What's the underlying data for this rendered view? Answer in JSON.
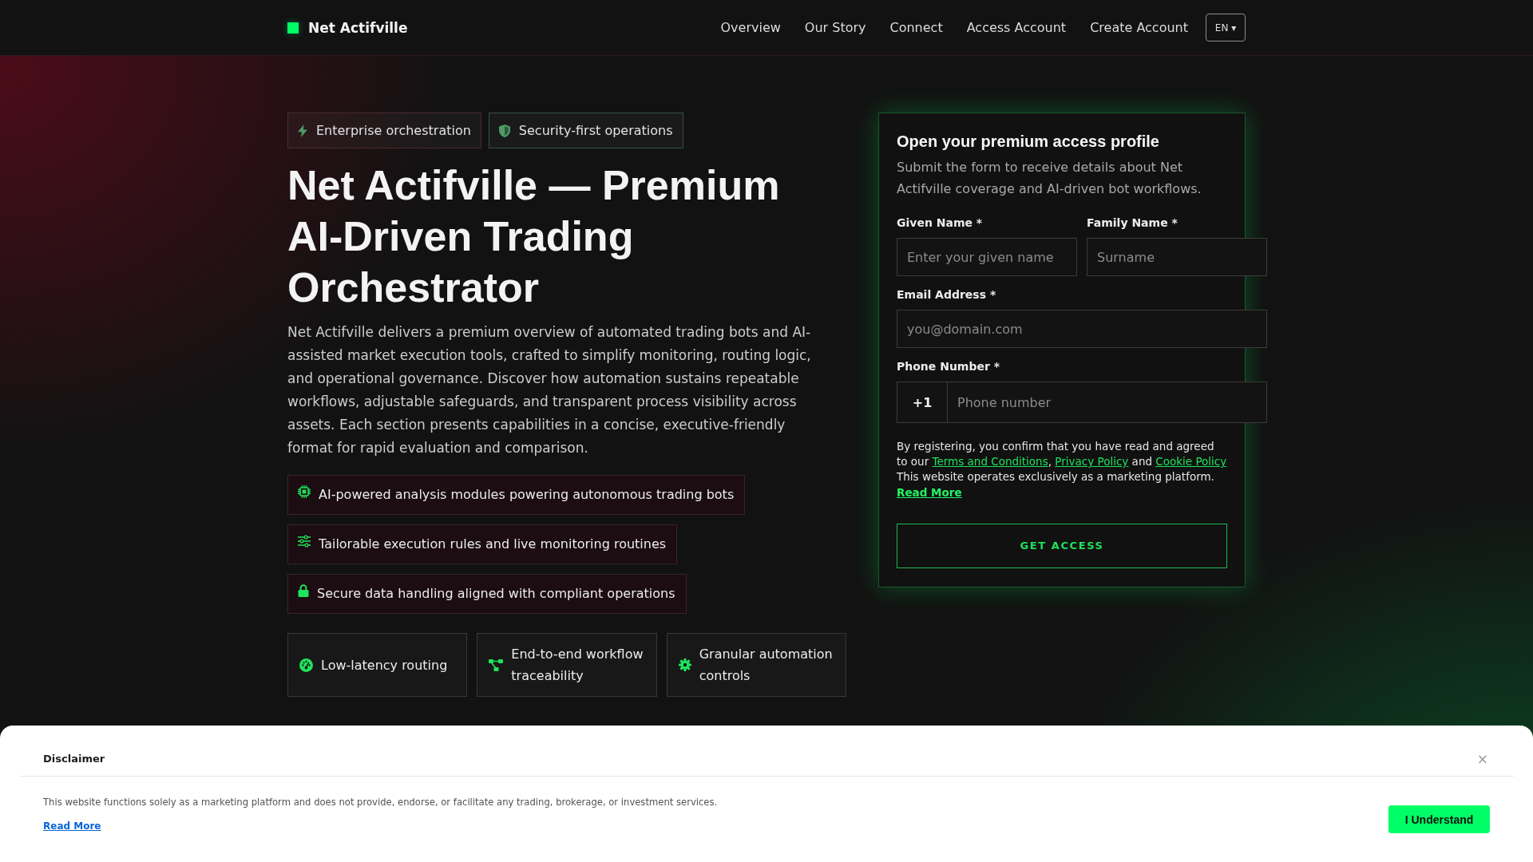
{
  "header": {
    "brand": "Net Actifville",
    "nav": [
      {
        "label": "Overview"
      },
      {
        "label": "Our Story"
      },
      {
        "label": "Connect"
      },
      {
        "label": "Access Account"
      },
      {
        "label": "Create Account"
      }
    ],
    "language": {
      "label": "EN",
      "caret": "▾"
    }
  },
  "hero": {
    "badges": [
      {
        "kind": "bolt",
        "label": "Enterprise orchestration"
      },
      {
        "kind": "shield",
        "label": "Security-first operations"
      }
    ],
    "title": "Net Actifville — Premium AI-Driven Trading Orchestrator",
    "description": "Net Actifville delivers a premium overview of automated trading bots and AI-assisted market execution tools, crafted to simplify monitoring, routing logic, and operational governance. Discover how automation sustains repeatable workflows, adjustable safeguards, and transparent process visibility across assets. Each section presents capabilities in a concise, executive-friendly format for rapid evaluation and comparison.",
    "features": [
      {
        "kind": "chip",
        "text": "AI-powered analysis modules powering autonomous trading bots"
      },
      {
        "kind": "sliders",
        "text": "Tailorable execution rules and live monitoring routines"
      },
      {
        "kind": "lock",
        "text": "Secure data handling aligned with compliant operations"
      }
    ],
    "highlights": [
      {
        "kind": "gauge",
        "text": "Low-latency routing"
      },
      {
        "kind": "diagram",
        "text": "End-to-end workflow traceability"
      },
      {
        "kind": "gear",
        "text": "Granular automation controls"
      }
    ]
  },
  "form": {
    "title": "Open your premium access profile",
    "subtitle": "Submit the form to receive details about Net Actifville coverage and AI-driven bot workflows.",
    "field_rows": [
      [
        {
          "label": "Given Name *",
          "placeholder": "Enter your given name"
        },
        {
          "label": "Family Name *",
          "placeholder": "Surname"
        }
      ],
      [
        {
          "label": "Email Address *",
          "placeholder": "you@domain.com"
        }
      ],
      [
        {
          "label": "Phone Number *",
          "prefix": "+1",
          "placeholder": "Phone number"
        }
      ]
    ],
    "consent": [
      {
        "kind": "text",
        "text": "By registering, you confirm that you have read and agreed to our "
      },
      {
        "kind": "link",
        "text": "Terms and Conditions"
      },
      {
        "kind": "text",
        "text": ", "
      },
      {
        "kind": "link",
        "text": "Privacy Policy"
      },
      {
        "kind": "text",
        "text": " and "
      },
      {
        "kind": "link",
        "text": "Cookie Policy"
      },
      {
        "kind": "text",
        "text": " This website operates exclusively as a marketing platform. "
      },
      {
        "kind": "strong_link",
        "text": "Read More"
      }
    ],
    "submit": "GET ACCESS"
  },
  "disclaimer": {
    "title": "Disclaimer",
    "close": "×",
    "text": "This website functions solely as a marketing platform and does not provide, endorse, or facilitate any trading, brokerage, or investment services.",
    "link": "Read More",
    "button": "I Understand"
  }
}
